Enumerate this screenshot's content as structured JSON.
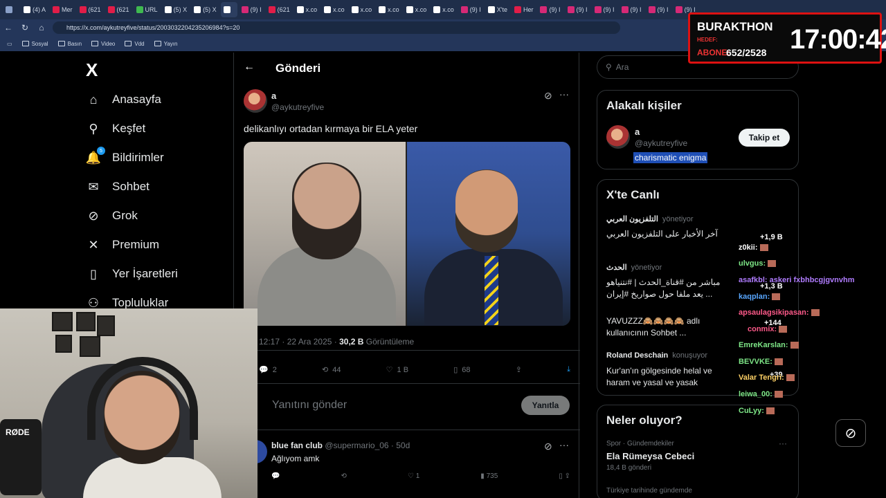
{
  "browser": {
    "tabs": [
      {
        "label": "",
        "color": "#8aa0c8"
      },
      {
        "label": "(4) A",
        "color": "#ffffff"
      },
      {
        "label": "Mer",
        "color": "#e11d48"
      },
      {
        "label": "(621",
        "color": "#e11d48"
      },
      {
        "label": "(621",
        "color": "#e11d48"
      },
      {
        "label": "URL",
        "color": "#3fb950"
      },
      {
        "label": "(5) X",
        "color": "#ffffff"
      },
      {
        "label": "(5) X",
        "color": "#ffffff"
      },
      {
        "label": "",
        "color": "#ffffff"
      },
      {
        "label": "(9) I",
        "color": "#d62976"
      },
      {
        "label": "(621",
        "color": "#e11d48"
      },
      {
        "label": "x.co",
        "color": "#ffffff"
      },
      {
        "label": "x.co",
        "color": "#ffffff"
      },
      {
        "label": "x.co",
        "color": "#ffffff"
      },
      {
        "label": "x.co",
        "color": "#ffffff"
      },
      {
        "label": "x.co",
        "color": "#ffffff"
      },
      {
        "label": "x.co",
        "color": "#ffffff"
      },
      {
        "label": "(9) I",
        "color": "#d62976"
      },
      {
        "label": "X'te",
        "color": "#ffffff"
      },
      {
        "label": "Her",
        "color": "#e11d48"
      },
      {
        "label": "(9) I",
        "color": "#d62976"
      },
      {
        "label": "(9) I",
        "color": "#d62976"
      },
      {
        "label": "(9) I",
        "color": "#d62976"
      },
      {
        "label": "(9) I",
        "color": "#d62976"
      },
      {
        "label": "(9) I",
        "color": "#d62976"
      },
      {
        "label": "(9) I",
        "color": "#d62976"
      }
    ],
    "url": "https://x.com/aykutreyfive/status/2003032204235206984?s=20",
    "bookmarks": [
      "Sosyal",
      "Basın",
      "Video",
      "Vdd",
      "Yayın"
    ]
  },
  "stream_overlay": {
    "name": "BURAKTHON",
    "target_label": "HEDEF:",
    "sub_label": "ABONE:",
    "sub_value": "652/2528",
    "time": "17:00:42"
  },
  "sidebar": {
    "logo": "X",
    "items": [
      {
        "label": "Anasayfa",
        "icon": "home-icon",
        "glyph": "⌂"
      },
      {
        "label": "Keşfet",
        "icon": "search-icon",
        "glyph": "⚲"
      },
      {
        "label": "Bildirimler",
        "icon": "bell-icon",
        "glyph": "🔔",
        "badge": "5"
      },
      {
        "label": "Sohbet",
        "icon": "mail-icon",
        "glyph": "✉"
      },
      {
        "label": "Grok",
        "icon": "grok-icon",
        "glyph": "⊘"
      },
      {
        "label": "Premium",
        "icon": "x-icon",
        "glyph": "✕"
      },
      {
        "label": "Yer İşaretleri",
        "icon": "bookmark-icon",
        "glyph": "▯"
      },
      {
        "label": "Topluluklar",
        "icon": "people-icon",
        "glyph": "⚇"
      }
    ]
  },
  "post": {
    "header_title": "Gönderi",
    "author_name": "a",
    "author_handle": "@aykutreyfive",
    "text": "delikanlıyı ortadan kırmaya bir ELA yeter",
    "time": "12:17 · 22 Ara 2025 · ",
    "views": "30,2 B",
    "views_label": " Görüntüleme",
    "replies": "2",
    "reposts": "44",
    "likes": "1 B",
    "bookmarks": "68",
    "reply_placeholder": "Yanıtını gönder",
    "reply_button": "Yanıtla"
  },
  "reply": {
    "name": "blue fan club",
    "meta": "@supermario_06 · 50d",
    "text": "Ağlıyom amk",
    "reposts": "",
    "likes": "1",
    "views": "735"
  },
  "right": {
    "search_placeholder": "Ara",
    "related_title": "Alakalı kişiler",
    "related_name": "a",
    "related_handle": "@aykutreyfive",
    "related_bio": "charismatic enigma",
    "follow_label": "Takip et",
    "live_title": "X'te Canlı",
    "live": [
      {
        "host": "التلفزيون العربي",
        "status": "yönetiyor",
        "title": "آخر الأخبار على التلفزيون العربي"
      },
      {
        "host": "الحدث",
        "status": "yönetiyor",
        "title": "مباشر من #قناة_الحدث | #نتنياهو يعد ملفا حول صواريخ #إيران ..."
      },
      {
        "host": "",
        "status": "",
        "title": "YAVUZZZ🙈🙈🙈🙈 adlı kullanıcının Sohbet ..."
      },
      {
        "host": "Roland Deschain",
        "status": "konuşuyor",
        "title": "Kur'an'ın gölgesinde helal ve haram ve yasal ve yasak"
      }
    ],
    "trends_title": "Neler oluyor?",
    "trend_meta": "Spor · Gündemdekiler",
    "trend_name": "Ela Rümeysa Cebeci",
    "trend_posts": "18,4 B gönderi",
    "trend2_meta": "Türkiye tarihinde gündemde"
  },
  "chat": [
    {
      "text": "+1,9 B",
      "color": "#ffffff"
    },
    {
      "text": "z0kii:",
      "color": "#ffffff"
    },
    {
      "text": "ulvgus:",
      "color": "#7ee787"
    },
    {
      "text": "asafkbl: askeri fxbhbcgjgvnvhm",
      "color": "#b07cff"
    },
    {
      "text": "+1,3 B",
      "color": "#ffffff"
    },
    {
      "text": "kaqplan:",
      "color": "#58a6ff"
    },
    {
      "text": "apsaulagsikipasan:",
      "color": "#ff5a8a"
    },
    {
      "text": "+144",
      "color": "#ffffff"
    },
    {
      "text": "conmix:",
      "color": "#ff5a8a"
    },
    {
      "text": "EmreKarslan:",
      "color": "#7ee787"
    },
    {
      "text": "BEVVKE:",
      "color": "#7ee787"
    },
    {
      "text": "+39",
      "color": "#ffffff"
    },
    {
      "text": "Valar Tengri:",
      "color": "#ffd166"
    },
    {
      "text": "leiwa_00:",
      "color": "#7ee787"
    },
    {
      "text": "CuLyy:",
      "color": "#7ee787"
    }
  ],
  "webcam": {
    "mic_brand": "RØDE"
  }
}
